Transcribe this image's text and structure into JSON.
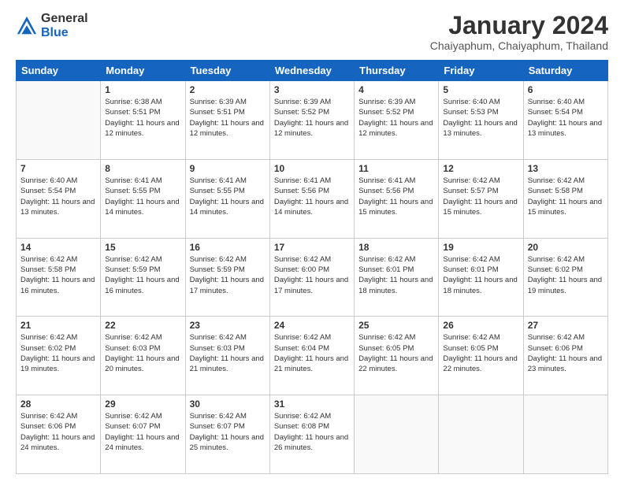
{
  "header": {
    "logo": {
      "general": "General",
      "blue": "Blue"
    },
    "title": "January 2024",
    "location": "Chaiyaphum, Chaiyaphum, Thailand"
  },
  "weekdays": [
    "Sunday",
    "Monday",
    "Tuesday",
    "Wednesday",
    "Thursday",
    "Friday",
    "Saturday"
  ],
  "weeks": [
    [
      {
        "day": "",
        "sunrise": "",
        "sunset": "",
        "daylight": ""
      },
      {
        "day": "1",
        "sunrise": "Sunrise: 6:38 AM",
        "sunset": "Sunset: 5:51 PM",
        "daylight": "Daylight: 11 hours and 12 minutes."
      },
      {
        "day": "2",
        "sunrise": "Sunrise: 6:39 AM",
        "sunset": "Sunset: 5:51 PM",
        "daylight": "Daylight: 11 hours and 12 minutes."
      },
      {
        "day": "3",
        "sunrise": "Sunrise: 6:39 AM",
        "sunset": "Sunset: 5:52 PM",
        "daylight": "Daylight: 11 hours and 12 minutes."
      },
      {
        "day": "4",
        "sunrise": "Sunrise: 6:39 AM",
        "sunset": "Sunset: 5:52 PM",
        "daylight": "Daylight: 11 hours and 12 minutes."
      },
      {
        "day": "5",
        "sunrise": "Sunrise: 6:40 AM",
        "sunset": "Sunset: 5:53 PM",
        "daylight": "Daylight: 11 hours and 13 minutes."
      },
      {
        "day": "6",
        "sunrise": "Sunrise: 6:40 AM",
        "sunset": "Sunset: 5:54 PM",
        "daylight": "Daylight: 11 hours and 13 minutes."
      }
    ],
    [
      {
        "day": "7",
        "sunrise": "Sunrise: 6:40 AM",
        "sunset": "Sunset: 5:54 PM",
        "daylight": "Daylight: 11 hours and 13 minutes."
      },
      {
        "day": "8",
        "sunrise": "Sunrise: 6:41 AM",
        "sunset": "Sunset: 5:55 PM",
        "daylight": "Daylight: 11 hours and 14 minutes."
      },
      {
        "day": "9",
        "sunrise": "Sunrise: 6:41 AM",
        "sunset": "Sunset: 5:55 PM",
        "daylight": "Daylight: 11 hours and 14 minutes."
      },
      {
        "day": "10",
        "sunrise": "Sunrise: 6:41 AM",
        "sunset": "Sunset: 5:56 PM",
        "daylight": "Daylight: 11 hours and 14 minutes."
      },
      {
        "day": "11",
        "sunrise": "Sunrise: 6:41 AM",
        "sunset": "Sunset: 5:56 PM",
        "daylight": "Daylight: 11 hours and 15 minutes."
      },
      {
        "day": "12",
        "sunrise": "Sunrise: 6:42 AM",
        "sunset": "Sunset: 5:57 PM",
        "daylight": "Daylight: 11 hours and 15 minutes."
      },
      {
        "day": "13",
        "sunrise": "Sunrise: 6:42 AM",
        "sunset": "Sunset: 5:58 PM",
        "daylight": "Daylight: 11 hours and 15 minutes."
      }
    ],
    [
      {
        "day": "14",
        "sunrise": "Sunrise: 6:42 AM",
        "sunset": "Sunset: 5:58 PM",
        "daylight": "Daylight: 11 hours and 16 minutes."
      },
      {
        "day": "15",
        "sunrise": "Sunrise: 6:42 AM",
        "sunset": "Sunset: 5:59 PM",
        "daylight": "Daylight: 11 hours and 16 minutes."
      },
      {
        "day": "16",
        "sunrise": "Sunrise: 6:42 AM",
        "sunset": "Sunset: 5:59 PM",
        "daylight": "Daylight: 11 hours and 17 minutes."
      },
      {
        "day": "17",
        "sunrise": "Sunrise: 6:42 AM",
        "sunset": "Sunset: 6:00 PM",
        "daylight": "Daylight: 11 hours and 17 minutes."
      },
      {
        "day": "18",
        "sunrise": "Sunrise: 6:42 AM",
        "sunset": "Sunset: 6:01 PM",
        "daylight": "Daylight: 11 hours and 18 minutes."
      },
      {
        "day": "19",
        "sunrise": "Sunrise: 6:42 AM",
        "sunset": "Sunset: 6:01 PM",
        "daylight": "Daylight: 11 hours and 18 minutes."
      },
      {
        "day": "20",
        "sunrise": "Sunrise: 6:42 AM",
        "sunset": "Sunset: 6:02 PM",
        "daylight": "Daylight: 11 hours and 19 minutes."
      }
    ],
    [
      {
        "day": "21",
        "sunrise": "Sunrise: 6:42 AM",
        "sunset": "Sunset: 6:02 PM",
        "daylight": "Daylight: 11 hours and 19 minutes."
      },
      {
        "day": "22",
        "sunrise": "Sunrise: 6:42 AM",
        "sunset": "Sunset: 6:03 PM",
        "daylight": "Daylight: 11 hours and 20 minutes."
      },
      {
        "day": "23",
        "sunrise": "Sunrise: 6:42 AM",
        "sunset": "Sunset: 6:03 PM",
        "daylight": "Daylight: 11 hours and 21 minutes."
      },
      {
        "day": "24",
        "sunrise": "Sunrise: 6:42 AM",
        "sunset": "Sunset: 6:04 PM",
        "daylight": "Daylight: 11 hours and 21 minutes."
      },
      {
        "day": "25",
        "sunrise": "Sunrise: 6:42 AM",
        "sunset": "Sunset: 6:05 PM",
        "daylight": "Daylight: 11 hours and 22 minutes."
      },
      {
        "day": "26",
        "sunrise": "Sunrise: 6:42 AM",
        "sunset": "Sunset: 6:05 PM",
        "daylight": "Daylight: 11 hours and 22 minutes."
      },
      {
        "day": "27",
        "sunrise": "Sunrise: 6:42 AM",
        "sunset": "Sunset: 6:06 PM",
        "daylight": "Daylight: 11 hours and 23 minutes."
      }
    ],
    [
      {
        "day": "28",
        "sunrise": "Sunrise: 6:42 AM",
        "sunset": "Sunset: 6:06 PM",
        "daylight": "Daylight: 11 hours and 24 minutes."
      },
      {
        "day": "29",
        "sunrise": "Sunrise: 6:42 AM",
        "sunset": "Sunset: 6:07 PM",
        "daylight": "Daylight: 11 hours and 24 minutes."
      },
      {
        "day": "30",
        "sunrise": "Sunrise: 6:42 AM",
        "sunset": "Sunset: 6:07 PM",
        "daylight": "Daylight: 11 hours and 25 minutes."
      },
      {
        "day": "31",
        "sunrise": "Sunrise: 6:42 AM",
        "sunset": "Sunset: 6:08 PM",
        "daylight": "Daylight: 11 hours and 26 minutes."
      },
      {
        "day": "",
        "sunrise": "",
        "sunset": "",
        "daylight": ""
      },
      {
        "day": "",
        "sunrise": "",
        "sunset": "",
        "daylight": ""
      },
      {
        "day": "",
        "sunrise": "",
        "sunset": "",
        "daylight": ""
      }
    ]
  ]
}
